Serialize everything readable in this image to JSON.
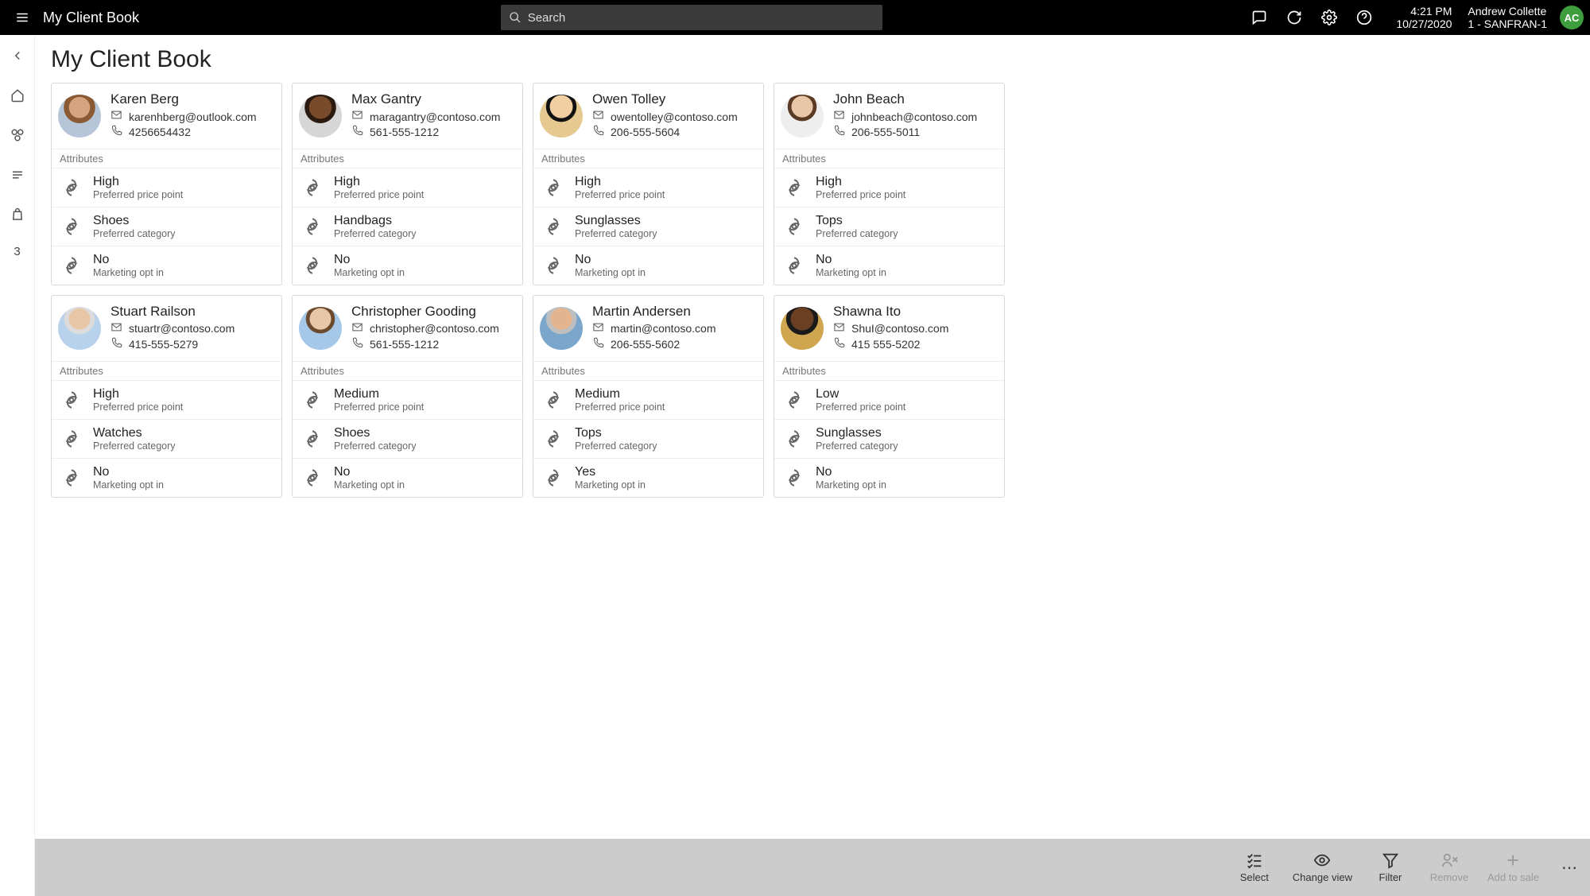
{
  "header": {
    "app_title": "My Client Book",
    "search_placeholder": "Search",
    "time": "4:21 PM",
    "date": "10/27/2020",
    "user_name": "Andrew Collette",
    "user_location": "1 - SANFRAN-1",
    "user_initials": "AC"
  },
  "side_rail": {
    "badge": "3"
  },
  "page": {
    "title": "My Client Book",
    "attributes_label": "Attributes",
    "attr_price_label": "Preferred price point",
    "attr_category_label": "Preferred category",
    "attr_optin_label": "Marketing opt in"
  },
  "clients": [
    {
      "name": "Karen Berg",
      "email": "karenhberg@outlook.com",
      "phone": "4256654432",
      "price": "High",
      "category": "Shoes",
      "optin": "No",
      "av": "av-1"
    },
    {
      "name": "Max Gantry",
      "email": "maragantry@contoso.com",
      "phone": "561-555-1212",
      "price": "High",
      "category": "Handbags",
      "optin": "No",
      "av": "av-2"
    },
    {
      "name": "Owen Tolley",
      "email": "owentolley@contoso.com",
      "phone": "206-555-5604",
      "price": "High",
      "category": "Sunglasses",
      "optin": "No",
      "av": "av-3"
    },
    {
      "name": "John Beach",
      "email": "johnbeach@contoso.com",
      "phone": "206-555-5011",
      "price": "High",
      "category": "Tops",
      "optin": "No",
      "av": "av-4"
    },
    {
      "name": "Stuart Railson",
      "email": "stuartr@contoso.com",
      "phone": "415-555-5279",
      "price": "High",
      "category": "Watches",
      "optin": "No",
      "av": "av-5"
    },
    {
      "name": "Christopher Gooding",
      "email": "christopher@contoso.com",
      "phone": "561-555-1212",
      "price": "Medium",
      "category": "Shoes",
      "optin": "No",
      "av": "av-6"
    },
    {
      "name": "Martin Andersen",
      "email": "martin@contoso.com",
      "phone": "206-555-5602",
      "price": "Medium",
      "category": "Tops",
      "optin": "Yes",
      "av": "av-7"
    },
    {
      "name": "Shawna Ito",
      "email": "ShuI@contoso.com",
      "phone": "415 555-5202",
      "price": "Low",
      "category": "Sunglasses",
      "optin": "No",
      "av": "av-8"
    }
  ],
  "bottom": {
    "select": "Select",
    "change_view": "Change view",
    "filter": "Filter",
    "remove": "Remove",
    "add_to_sale": "Add to sale"
  }
}
